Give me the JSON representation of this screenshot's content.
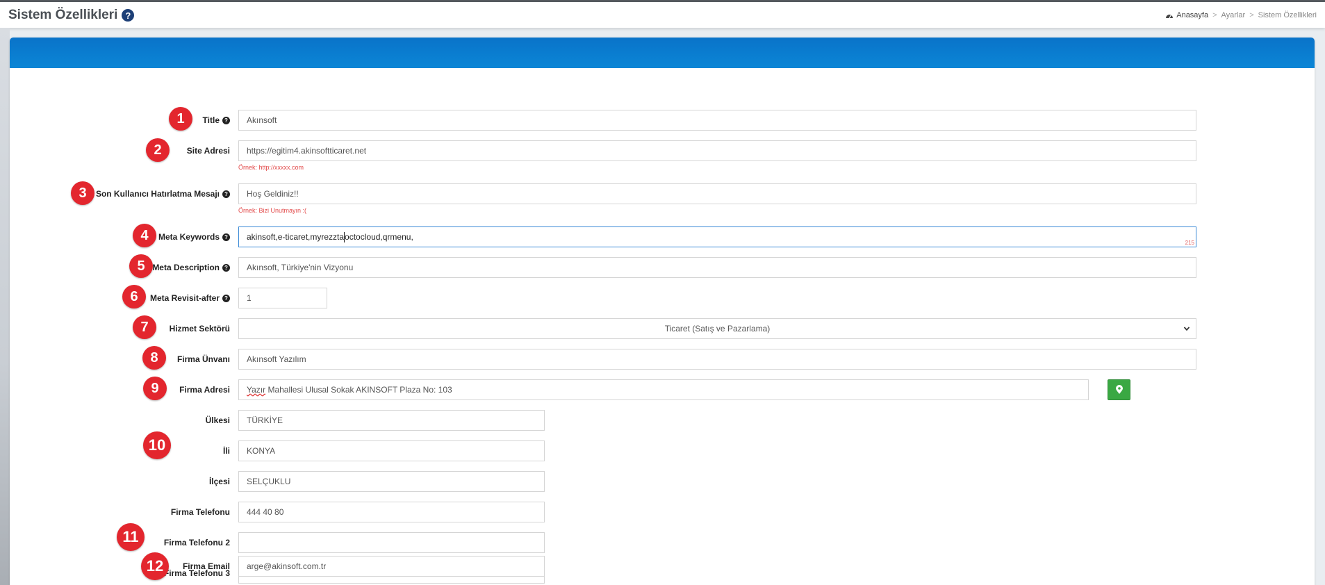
{
  "header": {
    "title": "Sistem Özellikleri",
    "help_glyph": "?",
    "breadcrumb": [
      "Anasayfa",
      "Ayarlar",
      "Sistem Özellikleri"
    ],
    "breadcrumb_sep": ">"
  },
  "colors": {
    "panel_header": "#0b7fd2",
    "badge": "#e3262e",
    "hint": "#e24a4a",
    "map_button": "#3aa843"
  },
  "icons": {
    "help": "question-circle-icon",
    "home": "dashboard-icon",
    "map": "map-marker-icon",
    "select": "chevron-down-icon"
  },
  "form": {
    "title": {
      "label": "Title",
      "value": "Akınsoft",
      "badge": "1"
    },
    "site_adresi": {
      "label": "Site Adresi",
      "value": "https://egitim4.akinsoftticaret.net",
      "hint": "Örnek: http://xxxxx.com",
      "badge": "2"
    },
    "hatirlatma": {
      "label": "Son Kullanıcı Hatırlatma Mesajı",
      "value": "Hoş Geldiniz!!",
      "hint": "Örnek: Bizi Unutmayın :(",
      "badge": "3"
    },
    "meta_keywords": {
      "label": "Meta Keywords",
      "value_before_caret": "akinsoft,e-ticaret,myrezzta",
      "value_after_caret": "octocloud,qrmenu,",
      "counter": "215",
      "badge": "4"
    },
    "meta_description": {
      "label": "Meta Description",
      "value": "Akınsoft, Türkiye'nin Vizyonu",
      "badge": "5"
    },
    "meta_revisit": {
      "label": "Meta Revisit-after",
      "value": "1",
      "badge": "6"
    },
    "hizmet_sektoru": {
      "label": "Hizmet Sektörü",
      "value": "Ticaret (Satış ve Pazarlama)",
      "badge": "7"
    },
    "firma_unvani": {
      "label": "Firma Ünvanı",
      "value": "Akınsoft Yazılım",
      "badge": "8"
    },
    "firma_adresi": {
      "label": "Firma Adresi",
      "value_word1": "Yazır",
      "value_rest": " Mahallesi Ulusal Sokak AKINSOFT Plaza No: 103",
      "badge": "9"
    },
    "ulkesi": {
      "label": "Ülkesi",
      "value": "TÜRKİYE"
    },
    "ili": {
      "label": "İli",
      "value": "KONYA"
    },
    "ilcesi": {
      "label": "İlçesi",
      "value": "SELÇUKLU"
    },
    "location_badge": "10",
    "firma_telefonu": {
      "label": "Firma Telefonu",
      "value": "444 40 80"
    },
    "firma_telefonu2": {
      "label": "Firma Telefonu 2",
      "value": "",
      "badge": "11"
    },
    "firma_telefonu3": {
      "label": "Firma Telefonu 3",
      "value": ""
    },
    "firma_email": {
      "label": "Firma Email",
      "value": "arge@akinsoft.com.tr",
      "badge": "12"
    }
  }
}
